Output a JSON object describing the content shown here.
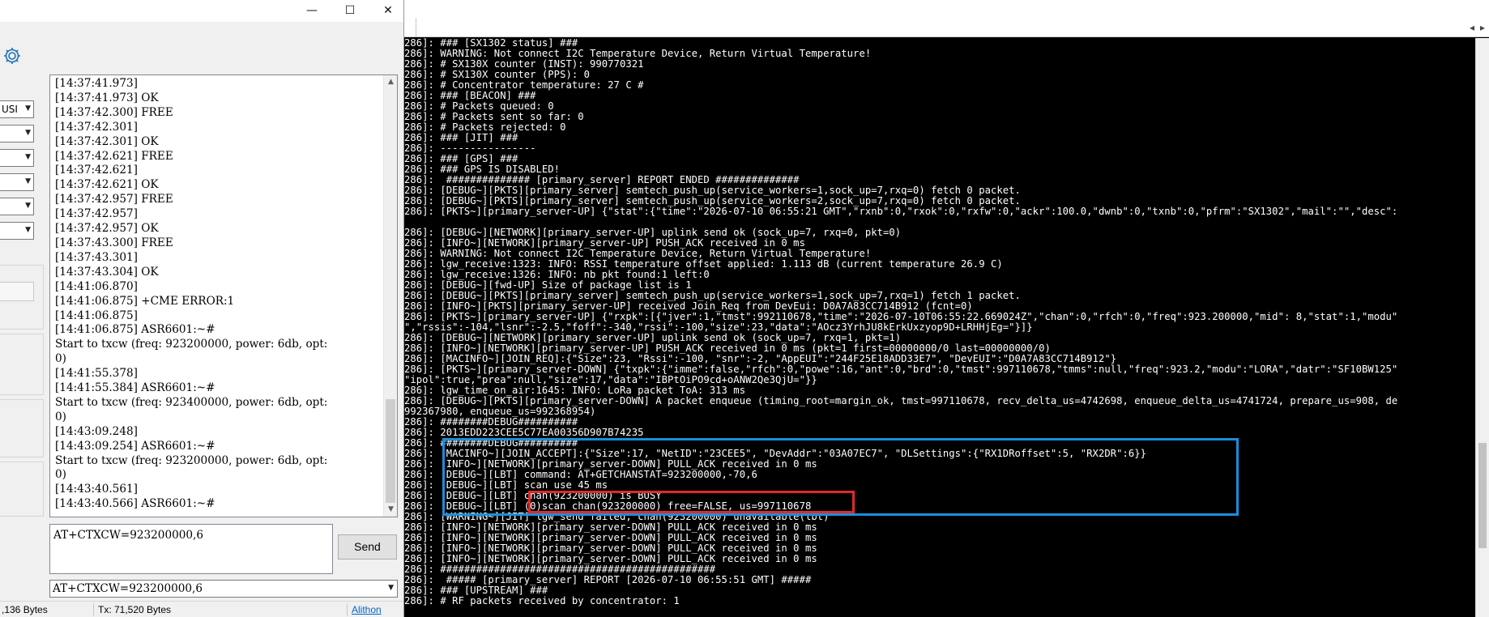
{
  "serial_window": {
    "controls": {
      "minimize": "—",
      "maximize": "☐",
      "close": "✕"
    },
    "port_combo_value": "USI",
    "receive_lines": [
      "[14:37:41.973]",
      "[14:37:41.973] OK",
      "[14:37:42.300] FREE",
      "[14:37:42.301]",
      "[14:37:42.301] OK",
      "[14:37:42.621] FREE",
      "[14:37:42.621]",
      "[14:37:42.621] OK",
      "[14:37:42.957] FREE",
      "[14:37:42.957]",
      "[14:37:42.957] OK",
      "[14:37:43.300] FREE",
      "[14:37:43.301]",
      "[14:37:43.304] OK",
      "[14:41:06.870]",
      "[14:41:06.875] +CME ERROR:1",
      "[14:41:06.875]",
      "[14:41:06.875] ASR6601:~#",
      "Start to txcw (freq: 923200000, power: 6db, opt:",
      "0)",
      "[14:41:55.378]",
      "[14:41:55.384] ASR6601:~#",
      "Start to txcw (freq: 923400000, power: 6db, opt:",
      "0)",
      "[14:43:09.248]",
      "[14:43:09.254] ASR6601:~#",
      "Start to txcw (freq: 923200000, power: 6db, opt:",
      "0)",
      "[14:43:40.561]",
      "[14:43:40.566] ASR6601:~#"
    ],
    "send_input_value": "AT+CTXCW=923200000,6",
    "send_button_label": "Send",
    "history_value": "AT+CTXCW=923200000,6",
    "status": {
      "rx": ",136 Bytes",
      "tx": "Tx: 71,520 Bytes",
      "link": "Alithon"
    }
  },
  "terminal": {
    "scroll_left_arrow": "◂",
    "scroll_right_arrow": "▸",
    "lines": [
      "286]: ### [SX1302 status] ###",
      "286]: WARNING: Not connect I2C Temperature Device, Return Virtual Temperature!",
      "286]: # SX130X counter (INST): 990770321",
      "286]: # SX130X counter (PPS): 0",
      "286]: # Concentrator temperature: 27 C #",
      "286]: ### [BEACON] ###",
      "286]: # Packets queued: 0",
      "286]: # Packets sent so far: 0",
      "286]: # Packets rejected: 0",
      "286]: ### [JIT] ###",
      "286]: ----------------",
      "286]: ### [GPS] ###",
      "286]: ### GPS IS DISABLED!",
      "286]:  ############## [primary_server] REPORT ENDED ##############",
      "286]: [DEBUG~][PKTS][primary_server] semtech_push_up(service_workers=1,sock_up=7,rxq=0) fetch 0 packet.",
      "286]: [DEBUG~][PKTS][primary_server] semtech_push_up(service_workers=2,sock_up=7,rxq=0) fetch 0 packet.",
      "286]: [PKTS~][primary_server-UP] {\"stat\":{\"time\":\"2026-07-10 06:55:21 GMT\",\"rxnb\":0,\"rxok\":0,\"rxfw\":0,\"ackr\":100.0,\"dwnb\":0,\"txnb\":0,\"pfrm\":\"SX1302\",\"mail\":\"\",\"desc\":",
      "",
      "286]: [DEBUG~][NETWORK][primary_server-UP] uplink send ok (sock_up=7, rxq=0, pkt=0)",
      "286]: [INFO~][NETWORK][primary_server-UP] PUSH_ACK received in 0 ms",
      "286]: WARNING: Not connect I2C Temperature Device, Return Virtual Temperature!",
      "286]: lgw_receive:1323: INFO: RSSI temperature offset applied: 1.113 dB (current temperature 26.9 C)",
      "286]: lgw_receive:1326: INFO: nb pkt found:1 left:0",
      "286]: [DEBUG~][fwd-UP] Size of package list is 1",
      "286]: [DEBUG~][PKTS][primary_server] semtech_push_up(service_workers=1,sock_up=7,rxq=1) fetch 1 packet.",
      "286]: [INFO~][PKTS][primary_server-UP] received Join_Req from DevEui: D0A7A83CC714B912 (fcnt=0)",
      "286]: [PKTS~][primary_server-UP] {\"rxpk\":[{\"jver\":1,\"tmst\":992110678,\"time\":\"2026-07-10T06:55:22.669024Z\",\"chan\":0,\"rfch\":0,\"freq\":923.200000,\"mid\": 8,\"stat\":1,\"modu\"",
      "\",\"rssis\":-104,\"lsnr\":-2.5,\"foff\":-340,\"rssi\":-100,\"size\":23,\"data\":\"AOcz3YrhJU8kErkUxzyop9D+LRHHjEg=\"}]}",
      "286]: [DEBUG~][NETWORK][primary_server-UP] uplink send ok (sock_up=7, rxq=1, pkt=1)",
      "286]: [INFO~][NETWORK][primary_server-UP] PUSH_ACK received in 0 ms (pkt=1 first=00000000/0 last=00000000/0)",
      "286]: [MACINFO~][JOIN_REQ]:{\"Size\":23, \"Rssi\":-100, \"snr\":-2, \"AppEUI\":\"244F25E18ADD33E7\", \"DevEUI\":\"D0A7A83CC714B912\"}",
      "286]: [PKTS~][primary_server-DOWN] {\"txpk\":{\"imme\":false,\"rfch\":0,\"powe\":16,\"ant\":0,\"brd\":0,\"tmst\":997110678,\"tmms\":null,\"freq\":923.2,\"modu\":\"LORA\",\"datr\":\"SF10BW125\"",
      "\"ipol\":true,\"prea\":null,\"size\":17,\"data\":\"IBPtOiPO9cd+oANW2Qe3QjU=\"}}",
      "286]: lgw_time_on_air:1645: INFO: LoRa packet ToA: 313 ms",
      "286]: [DEBUG~][PKTS][primary_server-DOWN] A packet enqueue (timing_root=margin_ok, tmst=997110678, recv_delta_us=4742698, enqueue_delta_us=4741724, prepare_us=908, de",
      "992367980, enqueue_us=992368954)",
      "286]: ########DEBUG##########",
      "286]: 2013EDD223CEE5C77EA00356D907B74235",
      "286]: ########DEBUG##########",
      "286]: [MACINFO~][JOIN_ACCEPT]:{\"Size\":17, \"NetID\":\"23CEE5\", \"DevAddr\":\"03A07EC7\", \"DLSettings\":{\"RX1DRoffset\":5, \"RX2DR\":6}}",
      "286]: [INFO~][NETWORK][primary_server-DOWN] PULL_ACK received in 0 ms",
      "286]: [DEBUG~][LBT] command: AT+GETCHANSTAT=923200000,-70,6",
      "286]: [DEBUG~][LBT] scan use 45 ms",
      "286]: [DEBUG~][LBT] chan(923200000) is BUSY",
      "286]: [DEBUG~][LBT] (0)scan chan(923200000) free=FALSE, us=997110678",
      "286]: [WARNING~][JIT] lgw_send failed, chan(923200000) unavailable(lbt)",
      "286]: [INFO~][NETWORK][primary_server-DOWN] PULL_ACK received in 0 ms",
      "286]: [INFO~][NETWORK][primary_server-DOWN] PULL_ACK received in 0 ms",
      "286]: [INFO~][NETWORK][primary_server-DOWN] PULL_ACK received in 0 ms",
      "286]: [INFO~][NETWORK][primary_server-DOWN] PULL_ACK received in 0 ms",
      "286]: ##############################################",
      "286]:  ##### [primary_server] REPORT [2026-07-10 06:55:51 GMT] #####",
      "286]: ### [UPSTREAM] ###",
      "286]: # RF packets received by concentrator: 1"
    ]
  },
  "colors": {
    "terminal_bg": "#000000",
    "terminal_fg": "#ffffff",
    "highlight_blue": "#1a8ee0",
    "highlight_red": "#e02a2a"
  }
}
